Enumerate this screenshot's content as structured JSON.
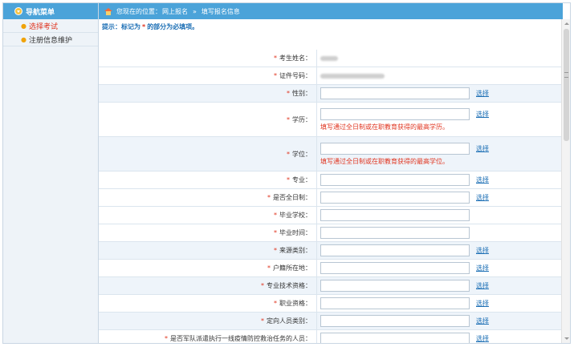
{
  "sidebar": {
    "header": "导航菜单",
    "items": [
      {
        "label": "选择考试",
        "active": true
      },
      {
        "label": "注册信息维护",
        "active": false
      }
    ]
  },
  "breadcrumb": {
    "prefix": "您现在的位置：",
    "section": "网上报名",
    "separator": "»",
    "current": "填写报名信息"
  },
  "hint": {
    "before": "提示：标记为",
    "star": "*",
    "after": "的部分为必填项。"
  },
  "form": {
    "choose_label": "选择",
    "rows": [
      {
        "label": "考生姓名：",
        "kind": "static"
      },
      {
        "label": "证件号码：",
        "kind": "static"
      },
      {
        "label": "性别：",
        "kind": "input",
        "choose": true
      },
      {
        "label": "学历：",
        "kind": "input",
        "choose": true,
        "note": "填写通过全日制或在职教育获得的最高学历。"
      },
      {
        "label": "学位：",
        "kind": "input",
        "choose": true,
        "note": "填写通过全日制或在职教育获得的最高学位。"
      },
      {
        "label": "专业：",
        "kind": "input",
        "choose": true
      },
      {
        "label": "是否全日制：",
        "kind": "input",
        "choose": true
      },
      {
        "label": "毕业学校：",
        "kind": "input",
        "choose": false
      },
      {
        "label": "毕业时间：",
        "kind": "input",
        "choose": false
      },
      {
        "label": "来源类别：",
        "kind": "input",
        "choose": true
      },
      {
        "label": "户籍所在地：",
        "kind": "input",
        "choose": true
      },
      {
        "label": "专业技术资格：",
        "kind": "input",
        "choose": true
      },
      {
        "label": "职业资格：",
        "kind": "input",
        "choose": true
      },
      {
        "label": "定向人员类别：",
        "kind": "input",
        "choose": true
      },
      {
        "label": "是否军队派遣执行一线疫情防控救治任务的人员：",
        "kind": "input",
        "choose": true
      }
    ]
  },
  "colors": {
    "header_blue": "#4ba3d9",
    "required_red": "#e0341f",
    "link_blue": "#1c6fb5",
    "row_alt": "#eef4fa"
  }
}
